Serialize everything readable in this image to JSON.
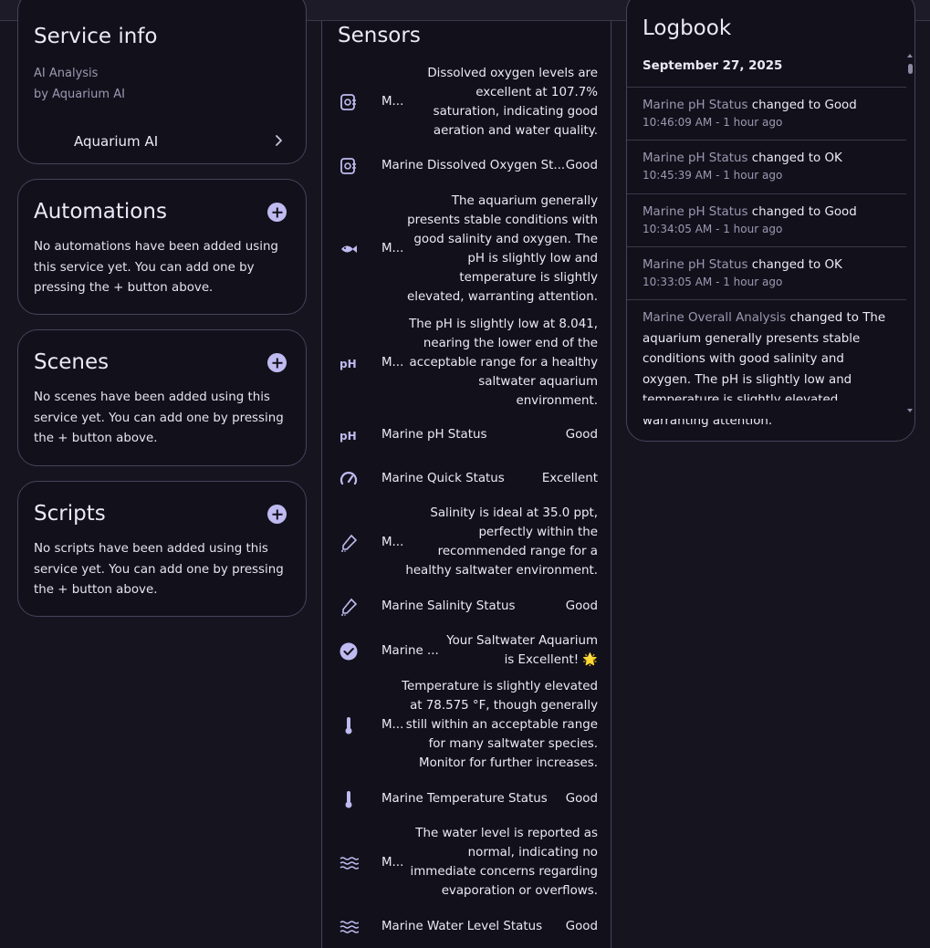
{
  "service_info": {
    "title": "Service info",
    "line1": "AI Analysis",
    "line2": "by Aquarium AI",
    "link_label": "Aquarium AI"
  },
  "automations": {
    "title": "Automations",
    "description": "No automations have been added using this service yet. You can add one by pressing the + button above."
  },
  "scenes": {
    "title": "Scenes",
    "description": "No scenes have been added using this service yet. You can add one by pressing the + button above."
  },
  "scripts": {
    "title": "Scripts",
    "description": "No scripts have been added using this service yet. You can add one by pressing the + button above."
  },
  "sensors": {
    "title": "Sensors",
    "rows": [
      {
        "icon": "oxygen-icon",
        "name": "M...",
        "value": "Dissolved oxygen levels are excellent at 107.7% saturation, indicating good aeration and water quality."
      },
      {
        "icon": "oxygen-icon",
        "name": "Marine Dissolved Oxygen St...",
        "value": "Good"
      },
      {
        "icon": "fish-icon",
        "name": "M...",
        "value": "The aquarium generally presents stable conditions with good salinity and oxygen. The pH is slightly low and temperature is slightly elevated, warranting attention."
      },
      {
        "icon": "ph-icon",
        "name": "M...",
        "value": "The pH is slightly low at 8.041, nearing the lower end of the acceptable range for a healthy saltwater aquarium environment."
      },
      {
        "icon": "ph-icon",
        "name": "Marine pH Status",
        "value": "Good"
      },
      {
        "icon": "gauge-icon",
        "name": "Marine Quick Status",
        "value": "Excellent"
      },
      {
        "icon": "salinity-icon",
        "name": "M...",
        "value": "Salinity is ideal at 35.0 ppt, perfectly within the recommended range for a healthy saltwater environment."
      },
      {
        "icon": "salinity-icon",
        "name": "Marine Salinity Status",
        "value": "Good"
      },
      {
        "icon": "check-circle-icon",
        "name": "Marine ...",
        "value": "Your Saltwater Aquarium is Excellent! 🌟"
      },
      {
        "icon": "thermometer-icon",
        "name": "M...",
        "value": "Temperature is slightly elevated at 78.575 °F, though generally still within an acceptable range for many saltwater species. Monitor for further increases."
      },
      {
        "icon": "thermometer-icon",
        "name": "Marine Temperature Status",
        "value": "Good"
      },
      {
        "icon": "waves-icon",
        "name": "M...",
        "value": "The water level is reported as normal, indicating no immediate concerns regarding evaporation or overflows."
      },
      {
        "icon": "waves-icon",
        "name": "Marine Water Level Status",
        "value": "Good"
      }
    ]
  },
  "logbook": {
    "title": "Logbook",
    "date": "September 27, 2025",
    "entries": [
      {
        "entity": "Marine pH Status",
        "text": " changed to Good",
        "time": "10:46:09 AM - 1 hour ago"
      },
      {
        "entity": "Marine pH Status",
        "text": " changed to OK",
        "time": "10:45:39 AM - 1 hour ago"
      },
      {
        "entity": "Marine pH Status",
        "text": " changed to Good",
        "time": "10:34:05 AM - 1 hour ago"
      },
      {
        "entity": "Marine pH Status",
        "text": " changed to OK",
        "time": "10:33:05 AM - 1 hour ago"
      },
      {
        "entity": "Marine Overall Analysis",
        "text": " changed to The aquarium generally presents stable conditions with good salinity and oxygen. The pH is slightly low and temperature is slightly elevated, warranting attention.",
        "time": ""
      }
    ]
  }
}
